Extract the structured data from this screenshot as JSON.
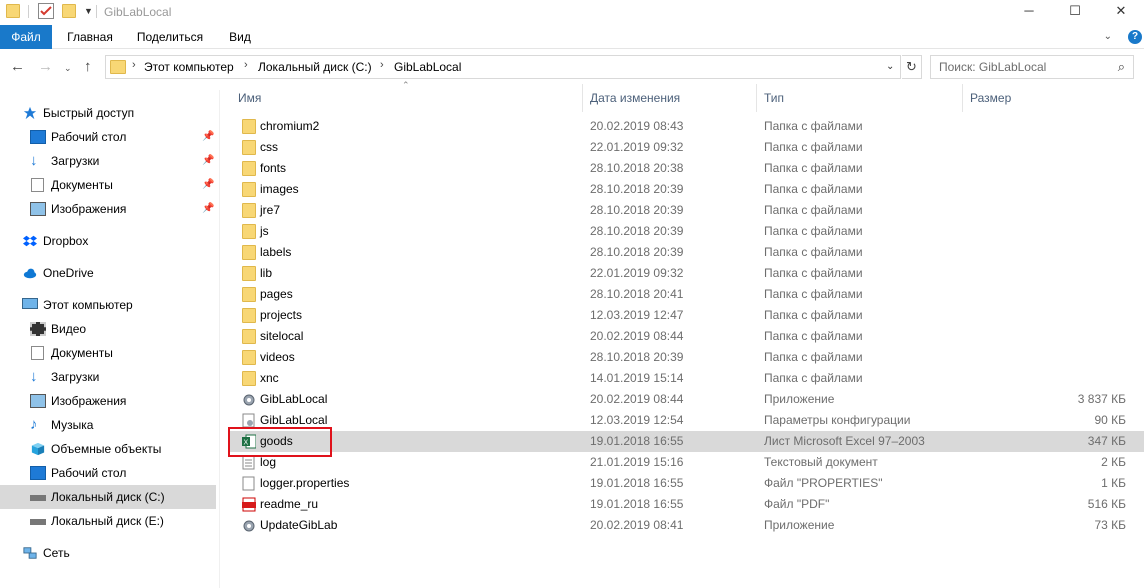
{
  "window": {
    "title": "GibLabLocal",
    "minimize": "─",
    "maximize": "☐",
    "close": "✕"
  },
  "ribbon": {
    "tabs": [
      "Файл",
      "Главная",
      "Поделиться",
      "Вид"
    ],
    "help": "?"
  },
  "address": {
    "crumbs": [
      "Этот компьютер",
      "Локальный диск (C:)",
      "GibLabLocal"
    ]
  },
  "search": {
    "placeholder": "Поиск: GibLabLocal"
  },
  "nav": {
    "quick_access": "Быстрый доступ",
    "desktop": "Рабочий стол",
    "downloads": "Загрузки",
    "documents": "Документы",
    "pictures": "Изображения",
    "dropbox": "Dropbox",
    "onedrive": "OneDrive",
    "this_pc": "Этот компьютер",
    "video": "Видео",
    "documents2": "Документы",
    "downloads2": "Загрузки",
    "pictures2": "Изображения",
    "music": "Музыка",
    "objects3d": "Объемные объекты",
    "desktop2": "Рабочий стол",
    "disk_c": "Локальный диск (C:)",
    "disk_e": "Локальный диск (E:)",
    "network": "Сеть"
  },
  "columns": {
    "name": "Имя",
    "date": "Дата изменения",
    "type": "Тип",
    "size": "Размер"
  },
  "files": [
    {
      "name": "chromium2",
      "date": "20.02.2019 08:43",
      "type": "Папка с файлами",
      "size": "",
      "icon": "folder"
    },
    {
      "name": "css",
      "date": "22.01.2019 09:32",
      "type": "Папка с файлами",
      "size": "",
      "icon": "folder"
    },
    {
      "name": "fonts",
      "date": "28.10.2018 20:38",
      "type": "Папка с файлами",
      "size": "",
      "icon": "folder"
    },
    {
      "name": "images",
      "date": "28.10.2018 20:39",
      "type": "Папка с файлами",
      "size": "",
      "icon": "folder"
    },
    {
      "name": "jre7",
      "date": "28.10.2018 20:39",
      "type": "Папка с файлами",
      "size": "",
      "icon": "folder"
    },
    {
      "name": "js",
      "date": "28.10.2018 20:39",
      "type": "Папка с файлами",
      "size": "",
      "icon": "folder"
    },
    {
      "name": "labels",
      "date": "28.10.2018 20:39",
      "type": "Папка с файлами",
      "size": "",
      "icon": "folder"
    },
    {
      "name": "lib",
      "date": "22.01.2019 09:32",
      "type": "Папка с файлами",
      "size": "",
      "icon": "folder"
    },
    {
      "name": "pages",
      "date": "28.10.2018 20:41",
      "type": "Папка с файлами",
      "size": "",
      "icon": "folder"
    },
    {
      "name": "projects",
      "date": "12.03.2019 12:47",
      "type": "Папка с файлами",
      "size": "",
      "icon": "folder"
    },
    {
      "name": "sitelocal",
      "date": "20.02.2019 08:44",
      "type": "Папка с файлами",
      "size": "",
      "icon": "folder"
    },
    {
      "name": "videos",
      "date": "28.10.2018 20:39",
      "type": "Папка с файлами",
      "size": "",
      "icon": "folder"
    },
    {
      "name": "xnc",
      "date": "14.01.2019 15:14",
      "type": "Папка с файлами",
      "size": "",
      "icon": "folder"
    },
    {
      "name": "GibLabLocal",
      "date": "20.02.2019 08:44",
      "type": "Приложение",
      "size": "3 837 КБ",
      "icon": "app"
    },
    {
      "name": "GibLabLocal",
      "date": "12.03.2019 12:54",
      "type": "Параметры конфигурации",
      "size": "90 КБ",
      "icon": "config"
    },
    {
      "name": "goods",
      "date": "19.01.2018 16:55",
      "type": "Лист Microsoft Excel 97–2003",
      "size": "347 КБ",
      "icon": "excel"
    },
    {
      "name": "log",
      "date": "21.01.2019 15:16",
      "type": "Текстовый документ",
      "size": "2 КБ",
      "icon": "text"
    },
    {
      "name": "logger.properties",
      "date": "19.01.2018 16:55",
      "type": "Файл \"PROPERTIES\"",
      "size": "1 КБ",
      "icon": "file"
    },
    {
      "name": "readme_ru",
      "date": "19.01.2018 16:55",
      "type": "Файл \"PDF\"",
      "size": "516 КБ",
      "icon": "pdf"
    },
    {
      "name": "UpdateGibLab",
      "date": "20.02.2019 08:41",
      "type": "Приложение",
      "size": "73 КБ",
      "icon": "app"
    }
  ]
}
